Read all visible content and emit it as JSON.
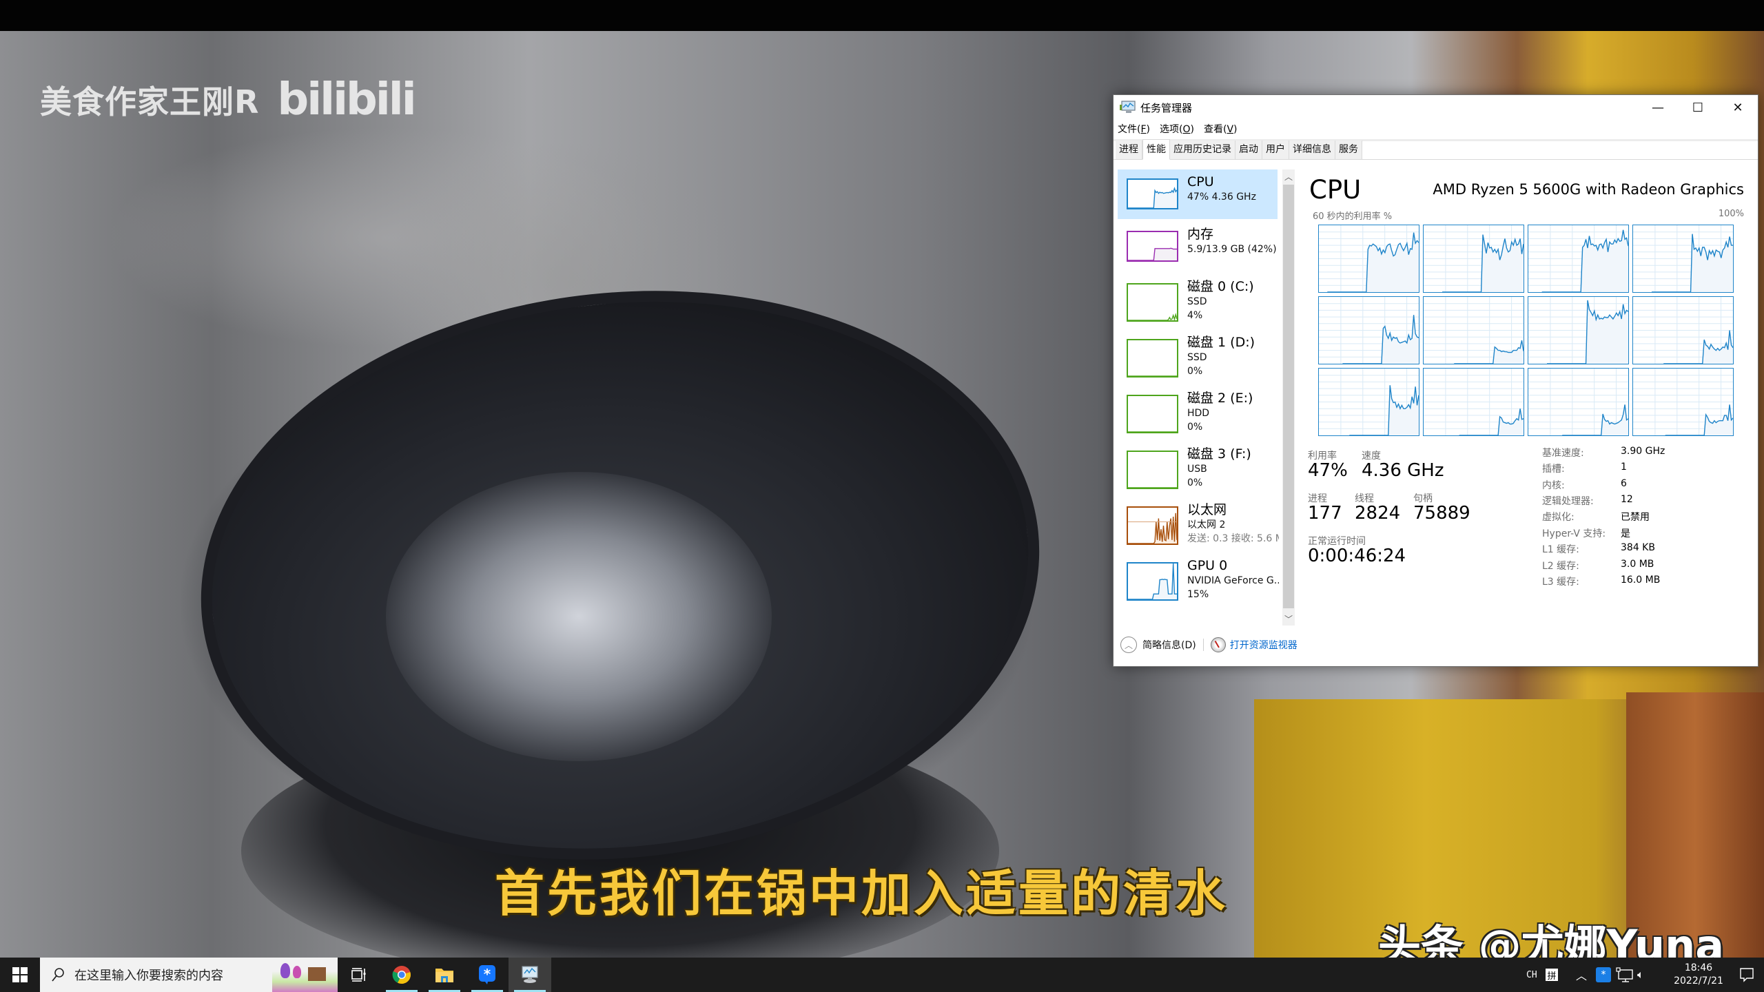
{
  "video": {
    "watermark_author": "美食作家王刚R",
    "watermark_logo": "bilibili",
    "subtitle": "首先我们在锅中加入适量的清水",
    "repost_watermark": "头条 @尤娜Yuna"
  },
  "task_manager": {
    "title": "任务管理器",
    "icon": "task-manager-icon",
    "window_controls": {
      "minimize": "—",
      "maximize": "☐",
      "close": "✕"
    },
    "menu": [
      {
        "label": "文件",
        "accel": "F"
      },
      {
        "label": "选项",
        "accel": "O"
      },
      {
        "label": "查看",
        "accel": "V"
      }
    ],
    "tabs": [
      {
        "label": "进程",
        "active": false
      },
      {
        "label": "性能",
        "active": true
      },
      {
        "label": "应用历史记录",
        "active": false
      },
      {
        "label": "启动",
        "active": false
      },
      {
        "label": "用户",
        "active": false
      },
      {
        "label": "详细信息",
        "active": false
      },
      {
        "label": "服务",
        "active": false
      }
    ],
    "sidebar": [
      {
        "title": "CPU",
        "sub1": "47% 4.36 GHz",
        "sub2": "",
        "selected": true,
        "color": "#1e84c9",
        "fill": "#f1f6fb",
        "spark": [
          0,
          0,
          0,
          0,
          0,
          0,
          0,
          0,
          0,
          0,
          0,
          0,
          0,
          0,
          0,
          0,
          0,
          0,
          0,
          0,
          0,
          0,
          62,
          55,
          58,
          52,
          56,
          54,
          55,
          52,
          53,
          54,
          55,
          54,
          56,
          55,
          62,
          56,
          70,
          58,
          64
        ]
      },
      {
        "title": "内存",
        "sub1": "5.9/13.9 GB (42%)",
        "sub2": "",
        "selected": false,
        "color": "#9a2cb0",
        "fill": "#f4f1f6",
        "spark": [
          0,
          0,
          0,
          0,
          0,
          0,
          0,
          0,
          0,
          0,
          0,
          0,
          0,
          0,
          0,
          0,
          0,
          0,
          0,
          0,
          0,
          0,
          42,
          42,
          42,
          42,
          42,
          42,
          42,
          42,
          42,
          42,
          42,
          42,
          42,
          43,
          42,
          40,
          40,
          40,
          40
        ]
      },
      {
        "title": "磁盘 0 (C:)",
        "sub1": "SSD",
        "sub2": "4%",
        "selected": false,
        "color": "#4ea51c",
        "fill": "#eef6e8",
        "spark": [
          0,
          0,
          0,
          0,
          0,
          0,
          0,
          0,
          0,
          0,
          0,
          0,
          0,
          0,
          0,
          0,
          0,
          0,
          0,
          0,
          0,
          0,
          0,
          0,
          0,
          0,
          0,
          0,
          0,
          0,
          0,
          0,
          0,
          2,
          8,
          2,
          4,
          14,
          3,
          16,
          4
        ]
      },
      {
        "title": "磁盘 1 (D:)",
        "sub1": "SSD",
        "sub2": "0%",
        "selected": false,
        "color": "#4ea51c",
        "fill": "#eef6e8",
        "spark": [
          0,
          0,
          0,
          0,
          0,
          0,
          0,
          0,
          0,
          0,
          0,
          0,
          0,
          0,
          0,
          0,
          0,
          0,
          0,
          0,
          0,
          0,
          0,
          0,
          0,
          0,
          0,
          0,
          0,
          0,
          0,
          0,
          0,
          0,
          0,
          0,
          0,
          0,
          0,
          0,
          0
        ]
      },
      {
        "title": "磁盘 2 (E:)",
        "sub1": "HDD",
        "sub2": "0%",
        "selected": false,
        "color": "#4ea51c",
        "fill": "#eef6e8",
        "spark": [
          0,
          0,
          0,
          0,
          0,
          0,
          0,
          0,
          0,
          0,
          0,
          0,
          0,
          0,
          0,
          0,
          0,
          0,
          0,
          0,
          0,
          0,
          0,
          0,
          0,
          0,
          0,
          0,
          0,
          0,
          0,
          0,
          0,
          0,
          0,
          0,
          0,
          0,
          0,
          0,
          0
        ]
      },
      {
        "title": "磁盘 3 (F:)",
        "sub1": "USB",
        "sub2": "0%",
        "selected": false,
        "color": "#4ea51c",
        "fill": "#eef6e8",
        "spark": [
          0,
          0,
          0,
          0,
          0,
          0,
          0,
          0,
          0,
          0,
          0,
          0,
          0,
          0,
          0,
          0,
          0,
          0,
          0,
          0,
          0,
          0,
          0,
          0,
          0,
          0,
          0,
          0,
          0,
          0,
          0,
          0,
          0,
          0,
          0,
          0,
          0,
          0,
          0,
          0,
          0
        ]
      },
      {
        "title": "以太网",
        "sub1": "以太网 2",
        "sub2": "发送: 0.3 接收: 5.6 M",
        "sub2_gray": true,
        "selected": false,
        "color": "#a74e0a",
        "fill": "#fbeee2",
        "spark": [
          0,
          0,
          0,
          0,
          0,
          0,
          0,
          0,
          0,
          0,
          0,
          0,
          0,
          0,
          0,
          0,
          0,
          0,
          0,
          0,
          0,
          0,
          5,
          60,
          10,
          70,
          8,
          40,
          5,
          50,
          10,
          8,
          60,
          12,
          50,
          70,
          10,
          75,
          5,
          85,
          10
        ]
      },
      {
        "title": "GPU 0",
        "sub1": "NVIDIA GeForce G...",
        "sub2": "15%",
        "selected": false,
        "color": "#1e84c9",
        "fill": "#f1f6fb",
        "spark": [
          0,
          0,
          0,
          0,
          0,
          0,
          0,
          0,
          0,
          0,
          0,
          0,
          0,
          0,
          0,
          0,
          0,
          0,
          0,
          0,
          0,
          15,
          15,
          15,
          15,
          15,
          55,
          55,
          56,
          55,
          56,
          55,
          55,
          15,
          15,
          15,
          15,
          100,
          15,
          15,
          15
        ]
      }
    ],
    "main": {
      "heading": "CPU",
      "model": "AMD Ryzen 5 5600G with Radeon Graphics",
      "graph_caption": "60 秒内的利用率 %",
      "graph_max": "100%",
      "stats": {
        "utilization_label": "利用率",
        "utilization": "47%",
        "speed_label": "速度",
        "speed": "4.36 GHz",
        "processes_label": "进程",
        "processes": "177",
        "threads_label": "线程",
        "threads": "2824",
        "handles_label": "句柄",
        "handles": "75889",
        "uptime_label": "正常运行时间",
        "uptime": "0:00:46:24"
      },
      "specs": [
        {
          "label": "基准速度:",
          "value": "3.90 GHz"
        },
        {
          "label": "插槽:",
          "value": "1"
        },
        {
          "label": "内核:",
          "value": "6"
        },
        {
          "label": "逻辑处理器:",
          "value": "12"
        },
        {
          "label": "虚拟化:",
          "value": "已禁用"
        },
        {
          "label": "Hyper-V 支持:",
          "value": "是"
        },
        {
          "label": "L1 缓存:",
          "value": "384 KB"
        },
        {
          "label": "L2 缓存:",
          "value": "3.0 MB"
        },
        {
          "label": "L3 缓存:",
          "value": "16.0 MB"
        }
      ]
    },
    "footer": {
      "fewer_details": "简略信息(D)",
      "resource_monitor": "打开资源监视器"
    }
  },
  "chart_data": {
    "type": "line",
    "title": "CPU",
    "xlabel": "60 秒内的利用率 %",
    "ylabel": "",
    "ylim": [
      0,
      100
    ],
    "grid": true,
    "series": [
      {
        "name": "logical-0",
        "values": [
          0,
          0,
          0,
          0,
          0,
          0,
          0,
          0,
          0,
          0,
          0,
          0,
          0,
          0,
          0,
          0,
          0,
          0,
          0,
          0,
          0,
          0,
          0,
          0,
          64,
          70,
          69,
          72,
          70,
          68,
          62,
          66,
          57,
          63,
          59,
          68,
          71,
          72,
          62,
          54,
          56,
          64,
          71,
          73,
          67,
          62,
          67,
          73,
          56,
          65,
          64,
          89,
          73,
          77,
          74
        ]
      },
      {
        "name": "logical-1",
        "values": [
          0,
          0,
          0,
          0,
          0,
          0,
          0,
          0,
          0,
          0,
          0,
          0,
          0,
          0,
          0,
          0,
          0,
          0,
          0,
          0,
          0,
          0,
          0,
          0,
          86,
          72,
          58,
          74,
          66,
          67,
          60,
          64,
          59,
          64,
          48,
          56,
          69,
          80,
          66,
          60,
          62,
          75,
          70,
          79,
          70,
          72,
          80,
          57,
          72
        ]
      },
      {
        "name": "logical-2",
        "values": [
          0,
          0,
          0,
          0,
          0,
          0,
          0,
          0,
          0,
          0,
          0,
          0,
          0,
          0,
          0,
          0,
          0,
          0,
          0,
          0,
          0,
          0,
          0,
          0,
          67,
          70,
          79,
          66,
          84,
          71,
          72,
          69,
          70,
          63,
          71,
          72,
          66,
          74,
          79,
          60,
          75,
          72,
          72,
          78,
          74,
          80,
          76,
          77,
          93,
          79,
          81,
          69
        ]
      },
      {
        "name": "logical-3",
        "values": [
          0,
          0,
          0,
          0,
          0,
          0,
          0,
          0,
          0,
          0,
          0,
          0,
          0,
          0,
          0,
          0,
          0,
          0,
          0,
          0,
          0,
          0,
          0,
          0,
          87,
          64,
          66,
          61,
          66,
          54,
          67,
          67,
          60,
          48,
          62,
          57,
          62,
          54,
          63,
          61,
          60,
          51,
          63,
          66,
          75,
          67,
          83,
          70,
          70
        ]
      },
      {
        "name": "logical-4",
        "values": [
          0,
          0,
          0,
          0,
          0,
          0,
          0,
          0,
          0,
          0,
          0,
          0,
          0,
          0,
          0,
          0,
          0,
          0,
          0,
          0,
          0,
          0,
          0,
          0,
          53,
          56,
          43,
          38,
          46,
          35,
          40,
          38,
          39,
          33,
          31,
          32,
          33,
          34,
          31,
          43,
          36,
          38,
          73,
          45,
          40,
          39
        ]
      },
      {
        "name": "logical-5",
        "values": [
          0,
          0,
          0,
          0,
          0,
          0,
          0,
          0,
          0,
          0,
          0,
          0,
          0,
          0,
          0,
          0,
          0,
          0,
          0,
          0,
          0,
          0,
          0,
          0,
          25,
          23,
          20,
          20,
          18,
          19,
          18,
          18,
          17,
          17,
          17,
          20,
          20,
          20,
          24,
          23,
          35,
          19
        ]
      },
      {
        "name": "logical-6",
        "values": [
          0,
          0,
          0,
          0,
          0,
          0,
          0,
          0,
          0,
          0,
          0,
          0,
          0,
          0,
          0,
          0,
          0,
          0,
          0,
          0,
          0,
          0,
          0,
          0,
          95,
          81,
          77,
          72,
          79,
          66,
          73,
          67,
          68,
          67,
          70,
          69,
          69,
          73,
          70,
          67,
          71,
          76,
          72,
          78,
          67,
          89,
          75,
          80,
          78
        ]
      },
      {
        "name": "logical-7",
        "values": [
          0,
          0,
          0,
          0,
          0,
          0,
          0,
          0,
          0,
          0,
          0,
          0,
          0,
          0,
          0,
          0,
          0,
          0,
          0,
          0,
          0,
          0,
          0,
          0,
          36,
          28,
          26,
          22,
          29,
          25,
          22,
          20,
          23,
          20,
          22,
          25,
          24,
          31,
          21,
          50,
          28,
          24
        ]
      },
      {
        "name": "logical-8",
        "values": [
          0,
          0,
          0,
          0,
          0,
          0,
          0,
          0,
          0,
          0,
          0,
          0,
          0,
          0,
          0,
          0,
          0,
          0,
          0,
          0,
          0,
          0,
          0,
          0,
          75,
          55,
          49,
          50,
          42,
          47,
          40,
          45,
          40,
          40,
          42,
          46,
          41,
          58,
          48,
          73,
          45,
          60
        ]
      },
      {
        "name": "logical-9",
        "values": [
          0,
          0,
          0,
          0,
          0,
          0,
          0,
          0,
          0,
          0,
          0,
          0,
          0,
          0,
          0,
          0,
          0,
          0,
          0,
          0,
          0,
          0,
          0,
          0,
          28,
          26,
          20,
          19,
          18,
          19,
          17,
          17,
          18,
          22,
          25,
          23,
          40,
          24,
          25
        ]
      },
      {
        "name": "logical-10",
        "values": [
          0,
          0,
          0,
          0,
          0,
          0,
          0,
          0,
          0,
          0,
          0,
          0,
          0,
          0,
          0,
          0,
          0,
          0,
          0,
          0,
          0,
          0,
          0,
          0,
          32,
          24,
          21,
          22,
          17,
          19,
          18,
          17,
          18,
          19,
          21,
          23,
          31,
          46,
          23,
          25
        ]
      },
      {
        "name": "logical-11",
        "values": [
          0,
          0,
          0,
          0,
          0,
          0,
          0,
          0,
          0,
          0,
          0,
          0,
          0,
          0,
          0,
          0,
          0,
          0,
          0,
          0,
          0,
          0,
          0,
          0,
          31,
          27,
          21,
          19,
          18,
          22,
          19,
          21,
          22,
          22,
          22,
          30,
          30,
          22,
          46,
          23,
          26
        ]
      }
    ]
  },
  "taskbar": {
    "search_placeholder": "在这里输入你要搜索的内容",
    "apps": [
      {
        "name": "task-view",
        "active": false,
        "running": false
      },
      {
        "name": "chrome",
        "active": false,
        "running": true
      },
      {
        "name": "file-explorer",
        "active": false,
        "running": true
      },
      {
        "name": "dingtalk",
        "active": false,
        "running": true
      },
      {
        "name": "task-manager",
        "active": true,
        "running": true
      }
    ],
    "tray": {
      "language": "CH",
      "ime": "拼",
      "time": "18:46",
      "date": "2022/7/21"
    }
  }
}
